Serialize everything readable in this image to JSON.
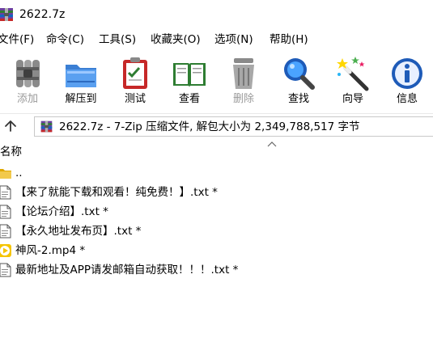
{
  "window": {
    "title": "2622.7z",
    "app_icon": "winrar-archive-icon"
  },
  "menu": [
    {
      "label": "文件(F)"
    },
    {
      "label": "命令(C)"
    },
    {
      "label": "工具(S)"
    },
    {
      "label": "收藏夹(O)"
    },
    {
      "label": "选项(N)"
    },
    {
      "label": "帮助(H)"
    }
  ],
  "toolbar": [
    {
      "label": "添加",
      "icon": "add-archive-icon",
      "enabled": false
    },
    {
      "label": "解压到",
      "icon": "extract-folder-icon",
      "enabled": true
    },
    {
      "label": "测试",
      "icon": "test-clipboard-icon",
      "enabled": true
    },
    {
      "label": "查看",
      "icon": "view-book-icon",
      "enabled": true
    },
    {
      "label": "删除",
      "icon": "delete-trash-icon",
      "enabled": false
    },
    {
      "label": "查找",
      "icon": "find-magnifier-icon",
      "enabled": true
    },
    {
      "label": "向导",
      "icon": "wizard-wand-icon",
      "enabled": true
    },
    {
      "label": "信息",
      "icon": "info-icon",
      "enabled": true
    }
  ],
  "address": {
    "text": "2622.7z - 7-Zip 压缩文件, 解包大小为 2,349,788,517 字节"
  },
  "columns": {
    "name": "名称"
  },
  "files": [
    {
      "name": "..",
      "icon": "folder-up-icon"
    },
    {
      "name": "【来了就能下载和观看！纯免费！】.txt *",
      "icon": "text-file-icon"
    },
    {
      "name": "【论坛介绍】.txt *",
      "icon": "text-file-icon"
    },
    {
      "name": "【永久地址发布页】.txt *",
      "icon": "text-file-icon"
    },
    {
      "name": "神风-2.mp4 *",
      "icon": "video-file-icon"
    },
    {
      "name": "最新地址及APP请发邮箱自动获取！！！.txt *",
      "icon": "text-file-icon"
    }
  ],
  "colors": {
    "disabled_text": "#9a9a9a",
    "folder": "#f2c94c",
    "video": "#f5c400"
  }
}
